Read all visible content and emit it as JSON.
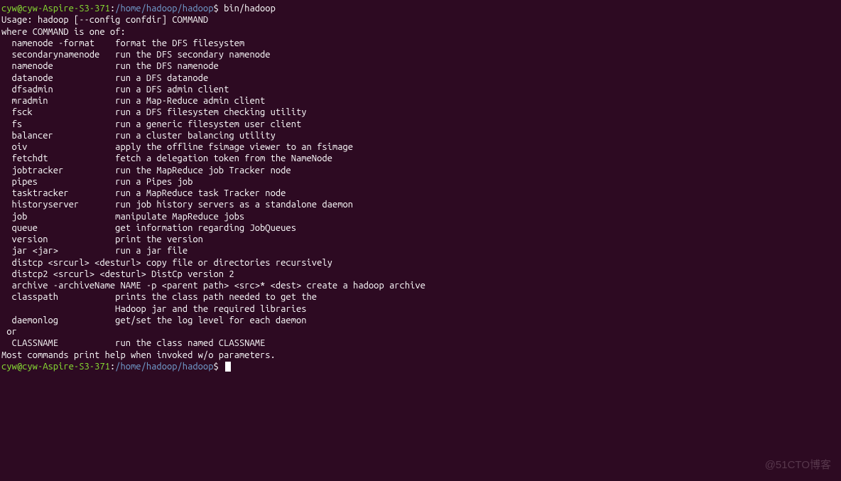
{
  "prompt1": {
    "user_host": "cyw@cyw-Aspire-S3-371",
    "separator": ":",
    "path": "/home/hadoop/hadoop",
    "symbol": "$ ",
    "command": "bin/hadoop"
  },
  "output": {
    "usage": "Usage: hadoop [--config confdir] COMMAND",
    "where": "where COMMAND is one of:",
    "commands": [
      {
        "name": "  namenode -format",
        "pad": "    ",
        "desc": "format the DFS filesystem"
      },
      {
        "name": "  secondarynamenode",
        "pad": "   ",
        "desc": "run the DFS secondary namenode"
      },
      {
        "name": "  namenode",
        "pad": "            ",
        "desc": "run the DFS namenode"
      },
      {
        "name": "  datanode",
        "pad": "            ",
        "desc": "run a DFS datanode"
      },
      {
        "name": "  dfsadmin",
        "pad": "            ",
        "desc": "run a DFS admin client"
      },
      {
        "name": "  mradmin",
        "pad": "             ",
        "desc": "run a Map-Reduce admin client"
      },
      {
        "name": "  fsck",
        "pad": "                ",
        "desc": "run a DFS filesystem checking utility"
      },
      {
        "name": "  fs",
        "pad": "                  ",
        "desc": "run a generic filesystem user client"
      },
      {
        "name": "  balancer",
        "pad": "            ",
        "desc": "run a cluster balancing utility"
      },
      {
        "name": "  oiv",
        "pad": "                 ",
        "desc": "apply the offline fsimage viewer to an fsimage"
      },
      {
        "name": "  fetchdt",
        "pad": "             ",
        "desc": "fetch a delegation token from the NameNode"
      },
      {
        "name": "  jobtracker",
        "pad": "          ",
        "desc": "run the MapReduce job Tracker node"
      },
      {
        "name": "  pipes",
        "pad": "               ",
        "desc": "run a Pipes job"
      },
      {
        "name": "  tasktracker",
        "pad": "         ",
        "desc": "run a MapReduce task Tracker node"
      },
      {
        "name": "  historyserver",
        "pad": "       ",
        "desc": "run job history servers as a standalone daemon"
      },
      {
        "name": "  job",
        "pad": "                 ",
        "desc": "manipulate MapReduce jobs"
      },
      {
        "name": "  queue",
        "pad": "               ",
        "desc": "get information regarding JobQueues"
      },
      {
        "name": "  version",
        "pad": "             ",
        "desc": "print the version"
      },
      {
        "name": "  jar <jar>",
        "pad": "           ",
        "desc": "run a jar file"
      }
    ],
    "distcp": "  distcp <srcurl> <desturl> copy file or directories recursively",
    "distcp2": "  distcp2 <srcurl> <desturl> DistCp version 2",
    "archive": "  archive -archiveName NAME -p <parent path> <src>* <dest> create a hadoop archive",
    "classpath1": "  classpath           prints the class path needed to get the",
    "classpath2": "                      Hadoop jar and the required libraries",
    "daemonlog": "  daemonlog           get/set the log level for each daemon",
    "or": " or",
    "classname": "  CLASSNAME           run the class named CLASSNAME",
    "footer": "Most commands print help when invoked w/o parameters."
  },
  "prompt2": {
    "user_host": "cyw@cyw-Aspire-S3-371",
    "separator": ":",
    "path": "/home/hadoop/hadoop",
    "symbol": "$ "
  },
  "watermark": "@51CTO博客"
}
